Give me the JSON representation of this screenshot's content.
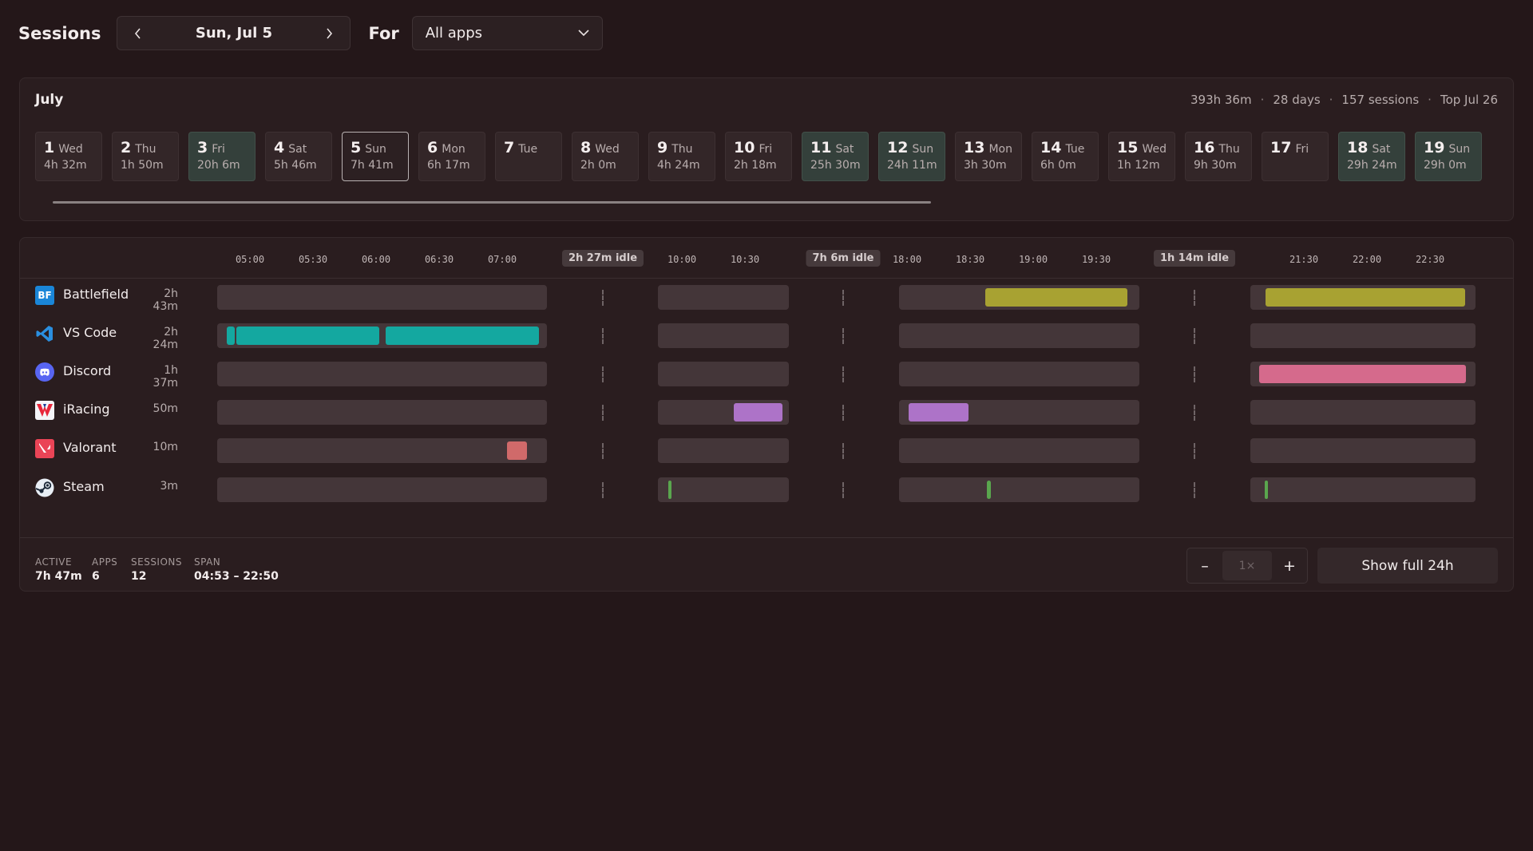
{
  "header": {
    "title": "Sessions",
    "date": "Sun, Jul 5",
    "for_label": "For",
    "app_filter": "All apps"
  },
  "month": {
    "title": "July",
    "total": "393h 36m",
    "days_count": "28 days",
    "sessions": "157 sessions",
    "top": "Top Jul 26",
    "days": [
      {
        "num": "1",
        "dow": "Wed",
        "dur": "4h 32m",
        "state": "normal"
      },
      {
        "num": "2",
        "dow": "Thu",
        "dur": "1h 50m",
        "state": "normal"
      },
      {
        "num": "3",
        "dow": "Fri",
        "dur": "20h 6m",
        "state": "hi"
      },
      {
        "num": "4",
        "dow": "Sat",
        "dur": "5h 46m",
        "state": "normal"
      },
      {
        "num": "5",
        "dow": "Sun",
        "dur": "7h 41m",
        "state": "sel"
      },
      {
        "num": "6",
        "dow": "Mon",
        "dur": "6h 17m",
        "state": "normal"
      },
      {
        "num": "7",
        "dow": "Tue",
        "dur": "",
        "state": "normal"
      },
      {
        "num": "8",
        "dow": "Wed",
        "dur": "2h 0m",
        "state": "normal"
      },
      {
        "num": "9",
        "dow": "Thu",
        "dur": "4h 24m",
        "state": "normal"
      },
      {
        "num": "10",
        "dow": "Fri",
        "dur": "2h 18m",
        "state": "normal"
      },
      {
        "num": "11",
        "dow": "Sat",
        "dur": "25h 30m",
        "state": "hi"
      },
      {
        "num": "12",
        "dow": "Sun",
        "dur": "24h 11m",
        "state": "hi"
      },
      {
        "num": "13",
        "dow": "Mon",
        "dur": "3h 30m",
        "state": "normal"
      },
      {
        "num": "14",
        "dow": "Tue",
        "dur": "6h 0m",
        "state": "normal"
      },
      {
        "num": "15",
        "dow": "Wed",
        "dur": "1h 12m",
        "state": "normal"
      },
      {
        "num": "16",
        "dow": "Thu",
        "dur": "9h 30m",
        "state": "normal"
      },
      {
        "num": "17",
        "dow": "Fri",
        "dur": "",
        "state": "normal"
      },
      {
        "num": "18",
        "dow": "Sat",
        "dur": "29h 24m",
        "state": "hi"
      },
      {
        "num": "19",
        "dow": "Sun",
        "dur": "29h 0m",
        "state": "hi"
      }
    ]
  },
  "timeline": {
    "ticks": [
      "05:00",
      "05:30",
      "06:00",
      "06:30",
      "07:00",
      "10:00",
      "10:30",
      "18:00",
      "18:30",
      "19:00",
      "19:30",
      "21:30",
      "22:00",
      "22:30"
    ],
    "idle_gaps": [
      "2h 27m idle",
      "7h 6m idle",
      "1h 14m idle"
    ],
    "apps": [
      {
        "name": "Battlefield",
        "duration": "2h 43m",
        "icon": "battlefield-icon",
        "icon_text": "BF",
        "icon_color": "#1a86d8",
        "color": "#a8a232"
      },
      {
        "name": "VS Code",
        "duration": "2h 24m",
        "icon": "vscode-icon",
        "icon_color": "#2a8fe0",
        "color": "#14a8a0"
      },
      {
        "name": "Discord",
        "duration": "1h 37m",
        "icon": "discord-icon",
        "icon_color": "#5865f2",
        "color": "#d56a8c"
      },
      {
        "name": "iRacing",
        "duration": "50m",
        "icon": "iracing-icon",
        "icon_color": "#e8253a",
        "color": "#ad73c8"
      },
      {
        "name": "Valorant",
        "duration": "10m",
        "icon": "valorant-icon",
        "icon_color": "#ea4456",
        "color": "#d06a6a"
      },
      {
        "name": "Steam",
        "duration": "3m",
        "icon": "steam-icon",
        "icon_color": "#1b2838",
        "color": "#5aa64e"
      }
    ]
  },
  "footer": {
    "active_label": "ACTIVE",
    "active": "7h 47m",
    "apps_label": "APPS",
    "apps": "6",
    "sessions_label": "SESSIONS",
    "sessions": "12",
    "span_label": "SPAN",
    "span": "04:53 – 22:50",
    "zoom_minus": "–",
    "zoom_value": "1×",
    "zoom_plus": "+",
    "show_full": "Show full 24h"
  }
}
